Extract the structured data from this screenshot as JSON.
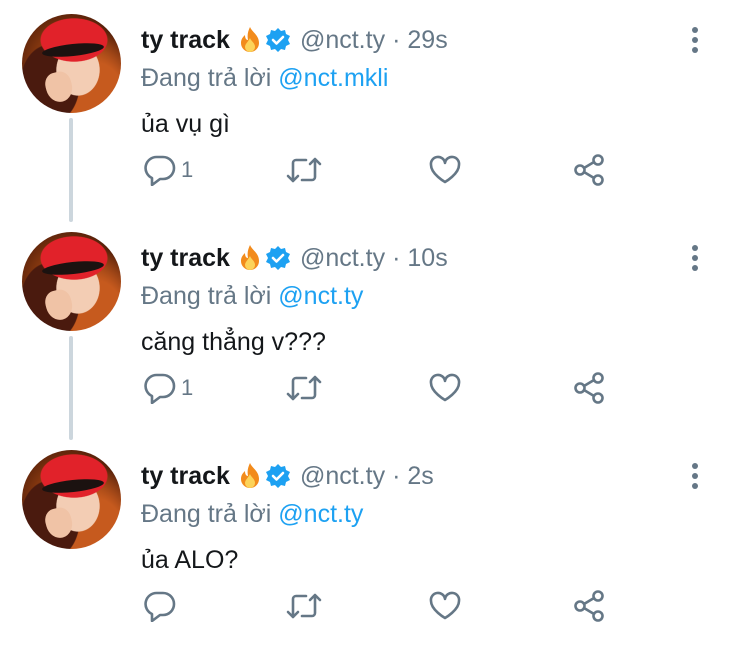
{
  "tweets": [
    {
      "name": "ty track",
      "handle": "@nct.ty",
      "separator": "·",
      "time": "29s",
      "reply_prefix": "Đang trả lời",
      "reply_to": "@nct.mkli",
      "text": "ủa vụ gì",
      "reply_count": "1"
    },
    {
      "name": "ty track",
      "handle": "@nct.ty",
      "separator": "·",
      "time": "10s",
      "reply_prefix": "Đang trả lời",
      "reply_to": "@nct.ty",
      "text": "căng thẳng v???",
      "reply_count": "1"
    },
    {
      "name": "ty track",
      "handle": "@nct.ty",
      "separator": "·",
      "time": "2s",
      "reply_prefix": "Đang trả lời",
      "reply_to": "@nct.ty",
      "text": "ủa ALO?",
      "reply_count": ""
    }
  ],
  "icons": {
    "name_badge": "fire-icon",
    "verified": "verified-badge-icon",
    "menu": "more-vertical-icon",
    "reply": "reply-icon",
    "retweet": "retweet-icon",
    "like": "heart-icon",
    "share": "share-icon"
  },
  "colors": {
    "text": "#14171a",
    "secondary": "#657786",
    "accent": "#1da1f2",
    "thread_line": "#ccd6dd"
  }
}
